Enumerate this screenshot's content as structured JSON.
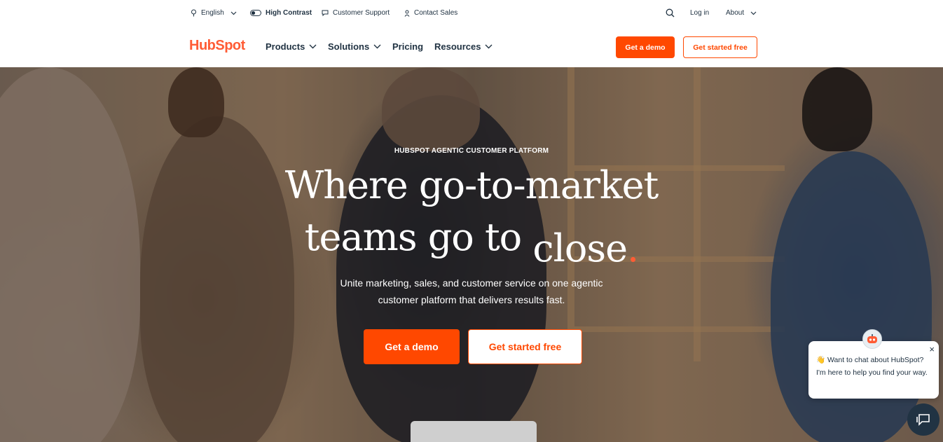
{
  "utility": {
    "language": "English",
    "high_contrast": "High Contrast",
    "customer_support": "Customer Support",
    "contact_sales": "Contact Sales",
    "login": "Log in",
    "about": "About"
  },
  "nav": {
    "logo": "HubSpot",
    "products": "Products",
    "solutions": "Solutions",
    "pricing": "Pricing",
    "resources": "Resources",
    "get_demo": "Get a demo",
    "get_started": "Get started free"
  },
  "hero": {
    "eyebrow": "HUBSPOT AGENTIC CUSTOMER PLATFORM",
    "headline_line1": "Where go-to-market",
    "headline_line2_start": "teams go to ",
    "headline_line2_word": "close",
    "headline_dot": ".",
    "subtitle_line1": "Unite marketing, sales, and customer service on one agentic",
    "subtitle_line2": "customer platform that delivers results fast.",
    "cta_demo": "Get a demo",
    "cta_free": "Get started free"
  },
  "chat": {
    "message": "👋 Want to chat about HubSpot? I'm here to help you find your way.",
    "close": "×"
  },
  "colors": {
    "brand_orange": "#ff4800",
    "logo_orange": "#ff5c35",
    "text_dark": "#213343"
  },
  "icons": [
    "globe-icon",
    "contrast-toggle-icon",
    "chat-bubble-icon",
    "person-icon",
    "search-icon",
    "chevron-down-icon",
    "close-icon",
    "chat-bot-avatar-icon",
    "chat-launcher-icon"
  ]
}
